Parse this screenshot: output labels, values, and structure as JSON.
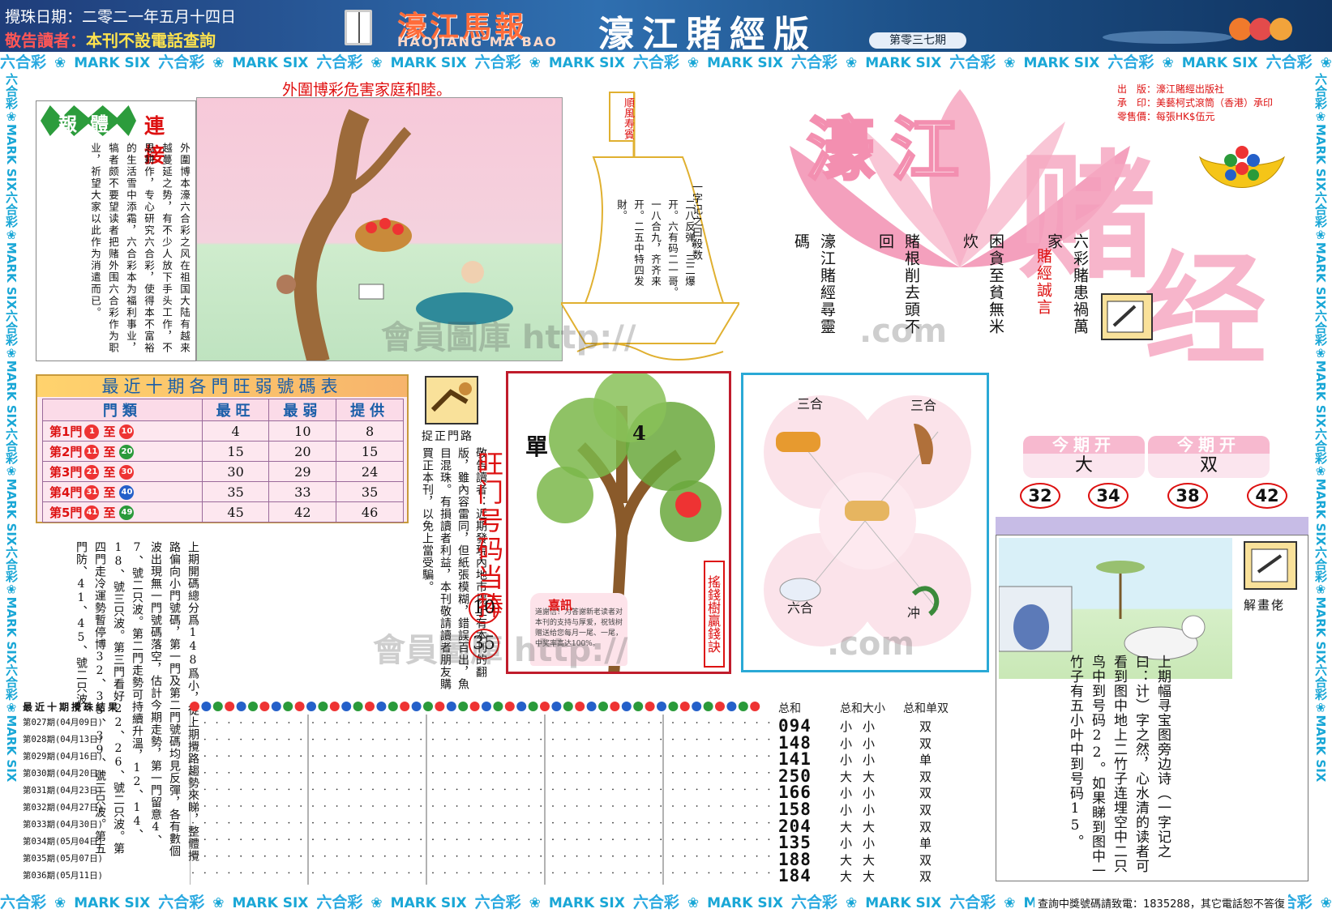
{
  "header": {
    "date": "攪珠日期：二零二一年五月十四日",
    "notice_prefix": "敬告讀者：",
    "notice_body": "本刊不設電話查詢",
    "logo": "濠江馬報",
    "logo_en": "HAOJIANG MA BAO",
    "edition": "濠江賭經版",
    "issue": "第零三七期"
  },
  "banner": {
    "cn": "六合彩",
    "en": "MARK SIX"
  },
  "slogan": "外圍博彩危害家庭和睦。",
  "top_left": {
    "title_green": "報體",
    "title_red": "連接",
    "text": "外圍博本濠六合彩之风在祖国大陆有越来越蔓延之势，有不少人放下手头工作，不思耕作，专心研究六合彩，使得本不富裕的生活雪中添霜，六合彩本为福利事业，犒者颇不要望读者把赌外围六合彩作为职业，祈望大家以此作为消遣而已。"
  },
  "sail": {
    "flag": "順風寿賓",
    "text_a": "二八反弹，三二爆开。六有码二一哥。一八合九，齐齐来开。二五中特四发財。",
    "text_b": "一字记之曰殺数"
  },
  "publisher": {
    "line1_k": "出　版：",
    "line1_v": "濠江賭經出版社",
    "line2_k": "承　印：",
    "line2_v": "美藝柯式滾筒（香港）承印",
    "line3_k": "零售價：",
    "line3_v": "每張HK$伍元"
  },
  "title_big": {
    "a": "濠江",
    "b": "赌",
    "c": "经"
  },
  "poem": {
    "col1": "六彩賭患禍萬家",
    "col2": "困貪至貧無米炊",
    "col3": "賭根削去頭不回",
    "col4": "濠江賭經尋靈碼",
    "label": "賭經誠言"
  },
  "table": {
    "title": "最近十期各門旺弱號碼表",
    "headers": [
      "門類",
      "最旺",
      "最弱",
      "提供"
    ],
    "rows": [
      {
        "gate": "第1門",
        "from": "1",
        "to": "10",
        "hot": "4",
        "cold": "10",
        "offer": "8"
      },
      {
        "gate": "第2門",
        "from": "11",
        "to": "20",
        "hot": "15",
        "cold": "20",
        "offer": "15"
      },
      {
        "gate": "第3門",
        "from": "21",
        "to": "30",
        "hot": "30",
        "cold": "29",
        "offer": "24"
      },
      {
        "gate": "第4門",
        "from": "31",
        "to": "40",
        "hot": "35",
        "cold": "33",
        "offer": "35"
      },
      {
        "gate": "第5門",
        "from": "41",
        "to": "49",
        "hot": "45",
        "cold": "42",
        "offer": "46"
      }
    ],
    "to_label": "至"
  },
  "icon1_label": "捉正門路",
  "wangmen": "旺门号码当捧",
  "wangmen_nums": [
    "10",
    "35"
  ],
  "body_mid": "敬告讀者：近期發現內地市場上有本刊的翻版，雖內容雷同，但紙張模糊，錯誤百出，魚目混珠。有損讀者利益，本刊敬請讀者朋友購買正本刊，以免上當受騙。",
  "body_left": "上期開碼總分爲148爲小，從上期攪路趨勢來睇，整體攪路偏向小門號碼，第一門及第二門號碼均見反彈，各有數個波出現無一門號碼落空，估計今期走勢，第一門留意4、7、號二只波。第二門走勢可持續升溫，12、14、18、號三只波。第三門看好22、26、號二只波。第四門走冷運勢暫停博32、33、39、號三只波。第五門防、41、45、號二只波。",
  "tree": {
    "dan": "單",
    "num": "4",
    "side": "搖錢樹贏錢訣",
    "note_title": "喜訊",
    "note_text": "道謝信！为答謝新老读者对本刊的支持与厚爱，祝钱树赠送给您每月一尾、一尾，中奖率高达100%。"
  },
  "zodiac": {
    "tl": "三合",
    "tr": "三合",
    "bl": "六合",
    "br": "冲",
    "com": ".com"
  },
  "result": {
    "h1": "今期开",
    "v1": "大",
    "h2": "今期开",
    "v2": "双",
    "nums": [
      "32",
      "34",
      "38",
      "42"
    ]
  },
  "rb": {
    "label": "解畫佬",
    "text": "上期幅寻宝图旁边诗（一字记之曰：计）字之然，心水清的读者可看到图中地上二竹子连埋空中二只鸟中到号码22。如果睇到图中一竹子有五小叶中到号码15。"
  },
  "draw": {
    "head": "最近十期攪珠結果",
    "rows": [
      {
        "issue": "第027期",
        "date": "(04月09日)",
        "sum": "094",
        "bs": "小",
        "sbs": "小",
        "oe": "双"
      },
      {
        "issue": "第028期",
        "date": "(04月13日)",
        "sum": "148",
        "bs": "小",
        "sbs": "小",
        "oe": "双"
      },
      {
        "issue": "第029期",
        "date": "(04月16日)",
        "sum": "141",
        "bs": "小",
        "sbs": "小",
        "oe": "单"
      },
      {
        "issue": "第030期",
        "date": "(04月20日)",
        "sum": "250",
        "bs": "大",
        "sbs": "大",
        "oe": "双"
      },
      {
        "issue": "第031期",
        "date": "(04月23日)",
        "sum": "166",
        "bs": "小",
        "sbs": "小",
        "oe": "双"
      },
      {
        "issue": "第032期",
        "date": "(04月27日)",
        "sum": "158",
        "bs": "小",
        "sbs": "小",
        "oe": "双"
      },
      {
        "issue": "第033期",
        "date": "(04月30日)",
        "sum": "204",
        "bs": "大",
        "sbs": "大",
        "oe": "双"
      },
      {
        "issue": "第034期",
        "date": "(05月04日)",
        "sum": "135",
        "bs": "小",
        "sbs": "小",
        "oe": "单"
      },
      {
        "issue": "第035期",
        "date": "(05月07日)",
        "sum": "188",
        "bs": "大",
        "sbs": "大",
        "oe": "双"
      },
      {
        "issue": "第036期",
        "date": "(05月11日)",
        "sum": "184",
        "bs": "大",
        "sbs": "大",
        "oe": "双"
      }
    ],
    "sum_head": "总和",
    "bs_head": "总和大小",
    "oe_head": "总和单双"
  },
  "footer_contact": "查詢中獎號碼請致電：1835288，其它電話恕不答復",
  "watermark": {
    "a": "會員圖庫 http://",
    "b": ".com",
    "c": "會員圖庫 http://"
  }
}
